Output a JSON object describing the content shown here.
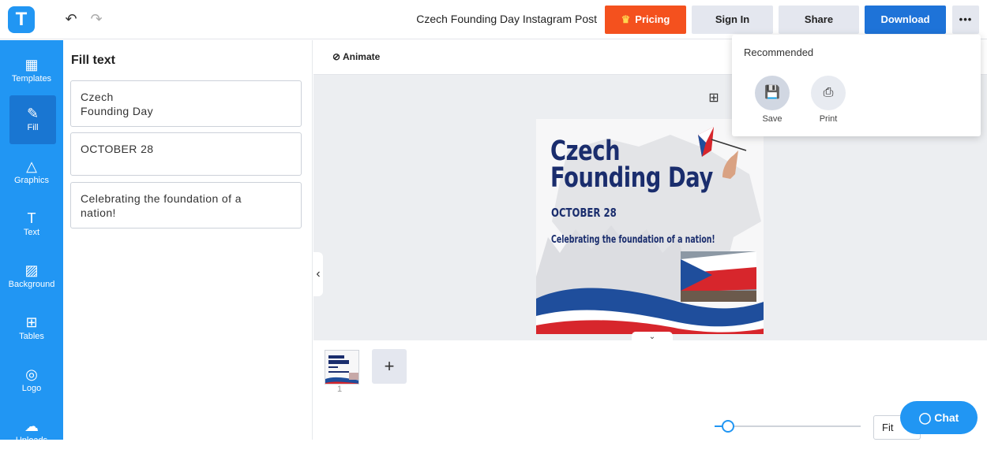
{
  "app": {
    "logo_letter": "T",
    "undo_icon": "undo-icon",
    "redo_icon": "redo-icon"
  },
  "header": {
    "title": "Czech Founding Day Instagram Post",
    "pricing_label": "Pricing",
    "signin_label": "Sign In",
    "share_label": "Share",
    "download_label": "Download",
    "more_label": "•••"
  },
  "sidebar": {
    "items": [
      {
        "label": "Templates",
        "icon": "templates-icon",
        "glyph": "▦"
      },
      {
        "label": "Fill",
        "icon": "pencil-icon",
        "glyph": "✎"
      },
      {
        "label": "Graphics",
        "icon": "shapes-icon",
        "glyph": "△"
      },
      {
        "label": "Text",
        "icon": "text-icon",
        "glyph": "T"
      },
      {
        "label": "Background",
        "icon": "background-icon",
        "glyph": "▨"
      },
      {
        "label": "Tables",
        "icon": "table-icon",
        "glyph": "⊞"
      },
      {
        "label": "Logo",
        "icon": "logo-icon",
        "glyph": "◎"
      },
      {
        "label": "Uploads",
        "icon": "upload-cloud-icon",
        "glyph": "☁"
      }
    ]
  },
  "panel": {
    "title": "Fill text",
    "fields": [
      {
        "value": "Czech\nFounding Day"
      },
      {
        "value": "OCTOBER 28"
      },
      {
        "value": "Celebrating the foundation of a\nnation!"
      }
    ]
  },
  "toolbar": {
    "animate_label": "Animate"
  },
  "design": {
    "title": "Czech\nFounding Day",
    "date": "OCTOBER 28",
    "subtitle": "Celebrating the foundation of a nation!",
    "colors": {
      "navy": "#1a2d6d",
      "red": "#d7262c",
      "blue": "#1f4e9c"
    }
  },
  "pages": {
    "page_number": "1",
    "add_label": "+"
  },
  "footer": {
    "fit_label": "Fit",
    "chat_label": "Chat",
    "zoom_value": 0.05
  },
  "dropdown": {
    "heading": "Recommended",
    "options": [
      {
        "label": "Save",
        "icon": "save-icon"
      },
      {
        "label": "Print",
        "icon": "print-icon"
      }
    ]
  }
}
